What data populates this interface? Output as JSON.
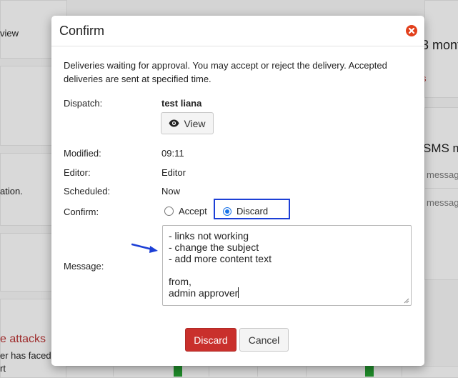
{
  "background": {
    "left_texts": [
      "view",
      "ation.",
      "e attacks",
      "er has faced",
      "rt"
    ],
    "right_texts": [
      "3 mont",
      "s",
      "SMS m",
      "messag",
      "messag"
    ]
  },
  "modal": {
    "title": "Confirm",
    "close_icon": "close-circle-icon",
    "intro": "Deliveries waiting for approval. You may accept or reject the delivery. Accepted deliveries are sent at specified time.",
    "dispatch": {
      "label": "Dispatch:",
      "value": "test liana",
      "view_button": "View",
      "view_icon": "eye-icon"
    },
    "modified": {
      "label": "Modified:",
      "value": "09:11"
    },
    "editor": {
      "label": "Editor:",
      "value": "Editor"
    },
    "scheduled": {
      "label": "Scheduled:",
      "value": "Now"
    },
    "confirm": {
      "label": "Confirm:",
      "options": [
        {
          "label": "Accept",
          "selected": false
        },
        {
          "label": "Discard",
          "selected": true
        }
      ]
    },
    "message": {
      "label": "Message:",
      "value": "- links not working\n- change the subject\n- add more content text\n\nfrom,\nadmin approver"
    },
    "buttons": {
      "discard": "Discard",
      "cancel": "Cancel"
    }
  },
  "colors": {
    "accent_blue": "#1a73e8",
    "highlight_box": "#1c3fd6",
    "danger": "#c9302c",
    "close_icon": "#e2401c"
  }
}
